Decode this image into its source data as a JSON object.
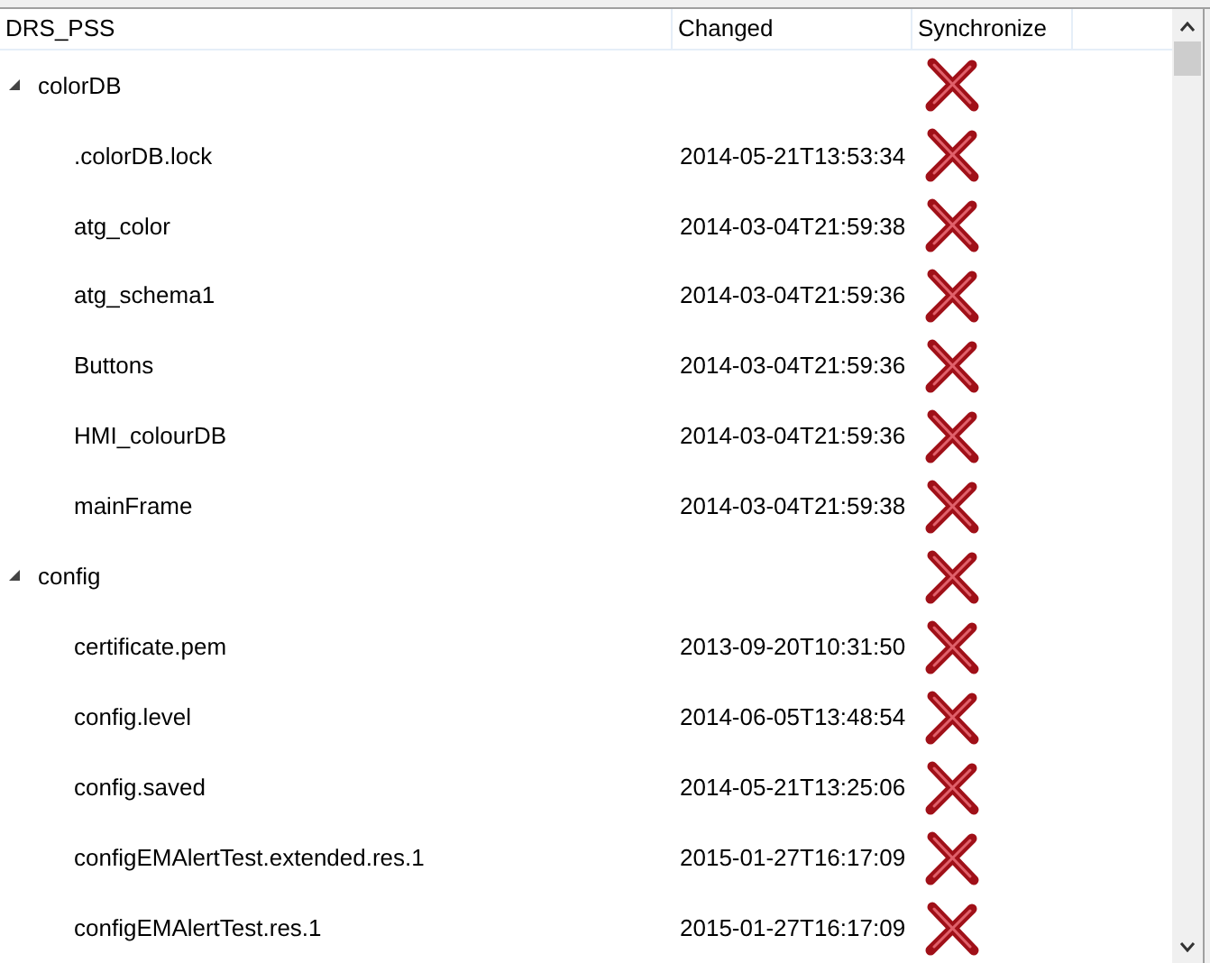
{
  "columns": [
    "DRS_PSS",
    "Changed",
    "Synchronize"
  ],
  "tree": [
    {
      "name": "colorDB",
      "expanded": true,
      "synced": false,
      "children": [
        {
          "name": ".colorDB.lock",
          "changed": "2014-05-21T13:53:34",
          "synced": false
        },
        {
          "name": "atg_color",
          "changed": "2014-03-04T21:59:38",
          "synced": false
        },
        {
          "name": "atg_schema1",
          "changed": "2014-03-04T21:59:36",
          "synced": false
        },
        {
          "name": "Buttons",
          "changed": "2014-03-04T21:59:36",
          "synced": false
        },
        {
          "name": "HMI_colourDB",
          "changed": "2014-03-04T21:59:36",
          "synced": false
        },
        {
          "name": "mainFrame",
          "changed": "2014-03-04T21:59:38",
          "synced": false
        }
      ]
    },
    {
      "name": "config",
      "expanded": true,
      "synced": false,
      "children": [
        {
          "name": "certificate.pem",
          "changed": "2013-09-20T10:31:50",
          "synced": false
        },
        {
          "name": "config.level",
          "changed": "2014-06-05T13:48:54",
          "synced": false
        },
        {
          "name": "config.saved",
          "changed": "2014-05-21T13:25:06",
          "synced": false
        },
        {
          "name": "configEMAlertTest.extended.res.1",
          "changed": "2015-01-27T16:17:09",
          "synced": false
        },
        {
          "name": "configEMAlertTest.res.1",
          "changed": "2015-01-27T16:17:09",
          "synced": false
        }
      ]
    }
  ]
}
